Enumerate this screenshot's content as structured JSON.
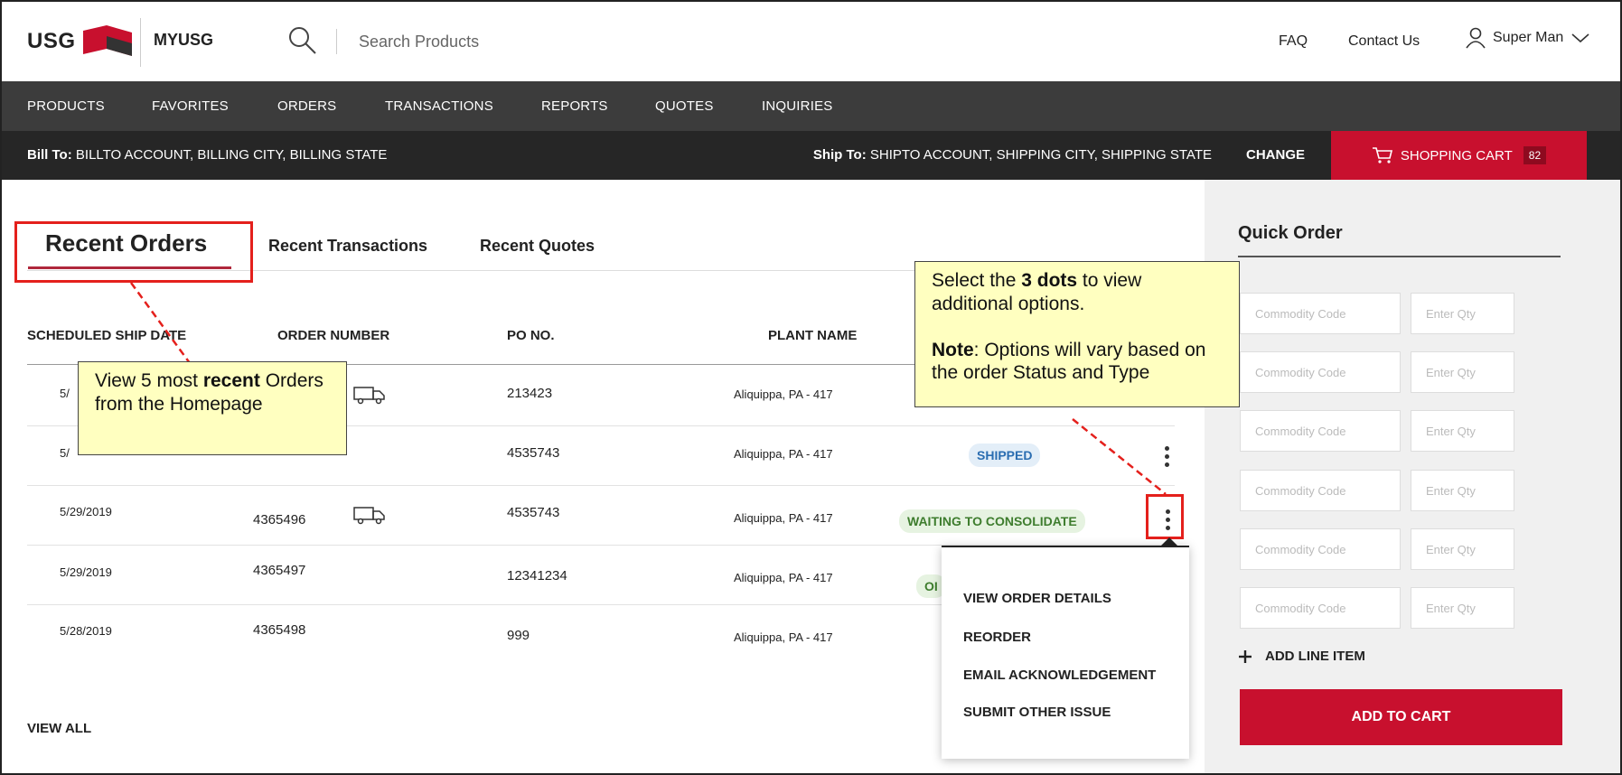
{
  "header": {
    "logo_text": "USG",
    "app_name": "MYUSG",
    "search_placeholder": "Search Products",
    "faq": "FAQ",
    "contact": "Contact Us",
    "user_name": "Super Man"
  },
  "nav": [
    "PRODUCTS",
    "FAVORITES",
    "ORDERS",
    "TRANSACTIONS",
    "REPORTS",
    "QUOTES",
    "INQUIRIES"
  ],
  "account_bar": {
    "bill_label": "Bill To:",
    "bill_value": "BILLTO ACCOUNT, BILLING CITY, BILLING STATE",
    "ship_label": "Ship To:",
    "ship_value": "SHIPTO ACCOUNT, SHIPPING CITY, SHIPPING STATE",
    "change": "CHANGE",
    "cart_label": "SHOPPING CART",
    "cart_count": "82"
  },
  "tabs": [
    "Recent Orders",
    "Recent Transactions",
    "Recent Quotes"
  ],
  "columns": [
    "SCHEDULED SHIP DATE",
    "ORDER NUMBER",
    "PO NO.",
    "PLANT NAME"
  ],
  "rows": [
    {
      "date": "5/",
      "order": "",
      "po": "213423",
      "plant": "Aliquippa, PA - 417",
      "status": ""
    },
    {
      "date": "5/",
      "order": "",
      "po": "4535743",
      "plant": "Aliquippa, PA - 417",
      "status": "SHIPPED"
    },
    {
      "date": "5/29/2019",
      "order": "4365496",
      "po": "4535743",
      "plant": "Aliquippa, PA - 417",
      "status": "WAITING TO CONSOLIDATE"
    },
    {
      "date": "5/29/2019",
      "order": "4365497",
      "po": "12341234",
      "plant": "Aliquippa, PA - 417",
      "status": "OI"
    },
    {
      "date": "5/28/2019",
      "order": "4365498",
      "po": "999",
      "plant": "Aliquippa, PA - 417",
      "status": ""
    }
  ],
  "view_all": "VIEW ALL",
  "menu": [
    "VIEW ORDER DETAILS",
    "REORDER",
    "EMAIL ACKNOWLEDGEMENT",
    "SUBMIT OTHER ISSUE"
  ],
  "quick_order": {
    "title": "Quick Order",
    "code_placeholder": "Commodity Code",
    "qty_placeholder": "Enter Qty",
    "add_line": "ADD LINE ITEM",
    "add_to_cart": "ADD TO CART"
  },
  "callouts": {
    "left": {
      "t1": "View 5 most ",
      "bold": "recent",
      "t2": " Orders from the Homepage"
    },
    "right": {
      "t1": "Select the ",
      "bold1": "3 dots",
      "t2": " to view additional options.",
      "bold2": "Note",
      "t3": ": Options will vary based on the order Status and Type"
    }
  },
  "colors": {
    "brand_red": "#c8102e",
    "nav_bg": "#3c3c3c",
    "bill_bg": "#262626",
    "callout_bg": "#ffffc0",
    "highlight": "#e4201c"
  }
}
